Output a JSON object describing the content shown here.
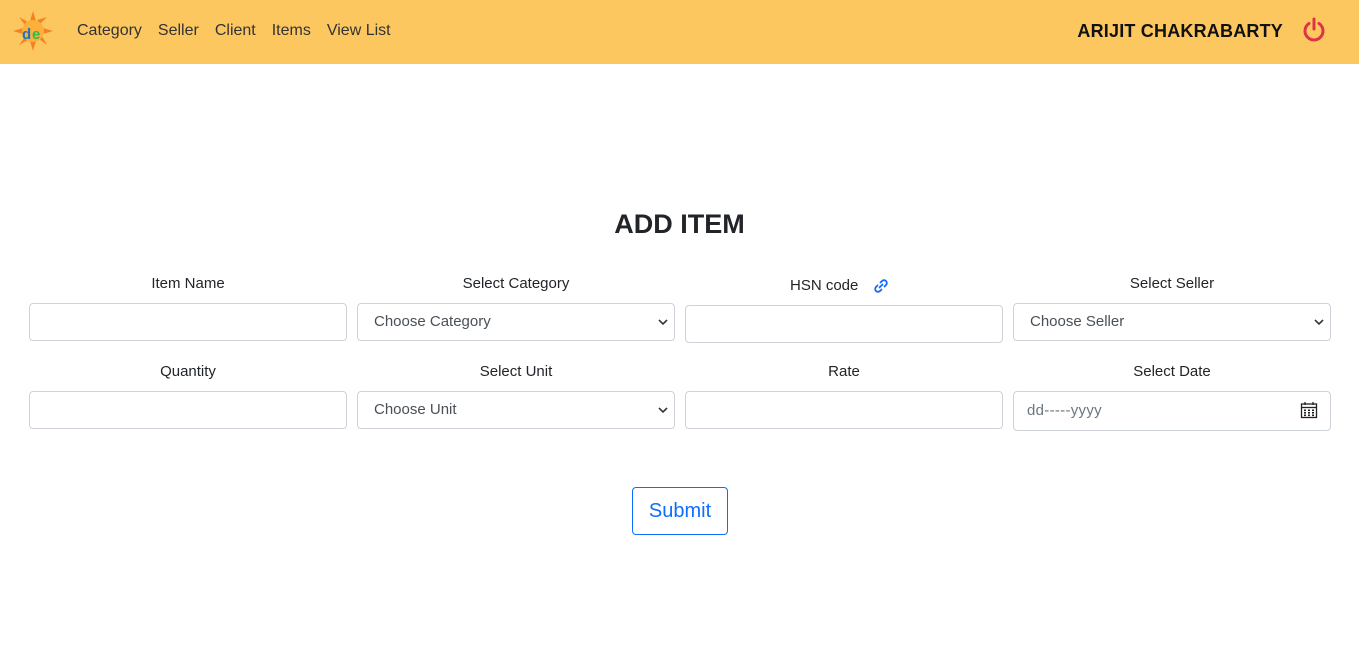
{
  "nav": {
    "links": [
      "Category",
      "Seller",
      "Client",
      "Items",
      "View List"
    ],
    "user_name": "ARIJIT CHAKRABARTY",
    "brand_color": "#fdc760",
    "power_color": "#dc3545"
  },
  "form": {
    "title": "ADD ITEM",
    "item_name_label": "Item Name",
    "category_label": "Select Category",
    "category_value": "Choose Category",
    "hsn_label": "HSN code",
    "seller_label": "Select Seller",
    "seller_value": "Choose Seller",
    "quantity_label": "Quantity",
    "unit_label": "Select Unit",
    "unit_value": "Choose Unit",
    "rate_label": "Rate",
    "date_label": "Select Date",
    "date_placeholder": "dd-----yyyy",
    "submit_label": "Submit"
  }
}
